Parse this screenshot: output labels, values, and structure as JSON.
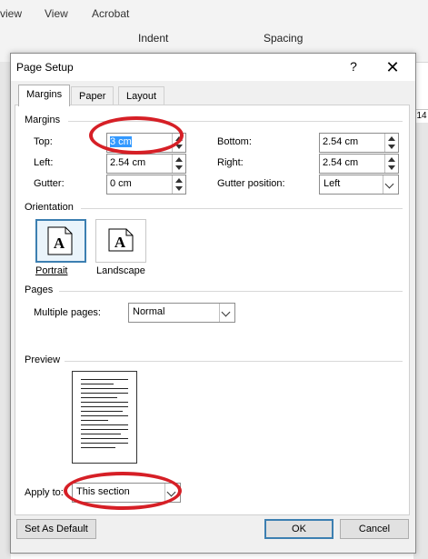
{
  "ribbon": {
    "tabs": [
      "view",
      "View",
      "Acrobat"
    ],
    "groups": {
      "indent": "Indent",
      "spacing": "Spacing"
    },
    "ruler_num": "14"
  },
  "dialog": {
    "title": "Page Setup",
    "help": "?",
    "close": "✕",
    "tabs": [
      "Margins",
      "Paper",
      "Layout"
    ],
    "margins": {
      "section_label": "Margins",
      "top_label": "Top:",
      "top_value": "3 cm",
      "bottom_label": "Bottom:",
      "bottom_value": "2.54 cm",
      "left_label": "Left:",
      "left_value": "2.54 cm",
      "right_label": "Right:",
      "right_value": "2.54 cm",
      "gutter_label": "Gutter:",
      "gutter_value": "0 cm",
      "gutter_pos_label": "Gutter position:",
      "gutter_pos_value": "Left"
    },
    "orientation": {
      "section_label": "Orientation",
      "portrait": "Portrait",
      "landscape": "Landscape",
      "glyph": "A"
    },
    "pages": {
      "section_label": "Pages",
      "multiple_label": "Multiple pages:",
      "multiple_value": "Normal"
    },
    "preview": {
      "section_label": "Preview"
    },
    "apply": {
      "label": "Apply to:",
      "value": "This section"
    },
    "buttons": {
      "default": "Set As Default",
      "ok": "OK",
      "cancel": "Cancel"
    }
  },
  "colors": {
    "annotation": "#d61f26",
    "accent": "#3c7fb1",
    "selection": "#3399ff"
  }
}
